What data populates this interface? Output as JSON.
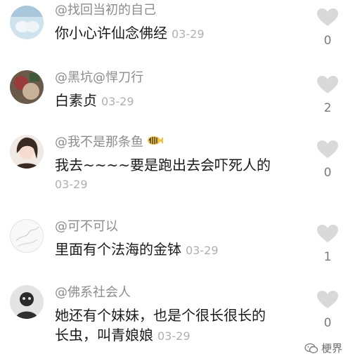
{
  "comments": [
    {
      "username": "@找回当初的自己",
      "lines": [
        "你小心许仙念佛经"
      ],
      "date": "03-29",
      "likes": "0"
    },
    {
      "username": "@黑坑@悍刀行",
      "lines": [
        "白素贞"
      ],
      "date": "03-29",
      "likes": "2"
    },
    {
      "username": "@我不是那条鱼",
      "lines": [
        "我去~~~~要是跑出去会吓死人的"
      ],
      "date": "03-29",
      "likes": "0"
    },
    {
      "username": "@可不可以",
      "lines": [
        "里面有个法海的金钵"
      ],
      "date": "03-29",
      "likes": "1"
    },
    {
      "username": "@佛系社会人",
      "lines": [
        "她还有个妹妹，也是个很长很长的",
        "长虫，叫青娘娘"
      ],
      "date": "03-29",
      "likes": "0"
    }
  ],
  "watermark": "梗界",
  "colors": {
    "heart": "#d9d9d9",
    "username": "#8c8c8c",
    "text": "#1a1a1a",
    "date": "#b0b0b0"
  }
}
